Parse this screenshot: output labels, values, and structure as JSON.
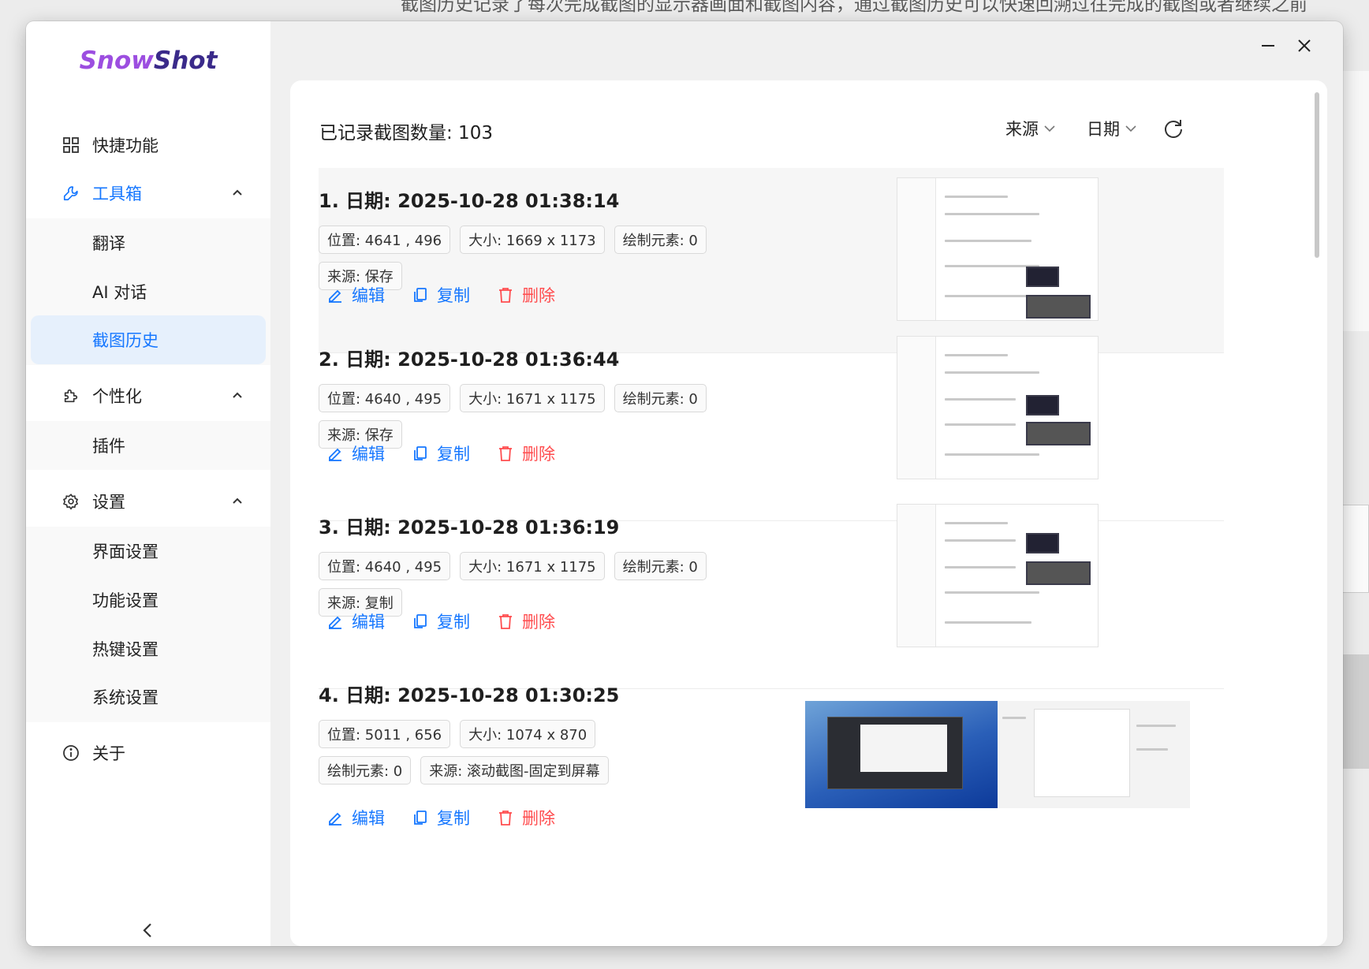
{
  "background": {
    "text": "截图历史记录了每次完成截图的显示器画面和截图内容，通过截图历史可以快速回溯过往完成的截图或者继续之前"
  },
  "app": {
    "logo_part1": "Snow",
    "logo_part2": "Shot"
  },
  "sidebar": {
    "quick": "快捷功能",
    "toolbox": "工具箱",
    "translate": "翻译",
    "ai_chat": "AI 对话",
    "history": "截图历史",
    "personalize": "个性化",
    "plugins": "插件",
    "settings": "设置",
    "ui_settings": "界面设置",
    "func_settings": "功能设置",
    "hotkey_settings": "热键设置",
    "system_settings": "系统设置",
    "about": "关于"
  },
  "content": {
    "count_label": "已记录截图数量: 103",
    "filter_source": "来源",
    "filter_date": "日期"
  },
  "actions": {
    "edit": "编辑",
    "copy": "复制",
    "delete": "删除"
  },
  "records": [
    {
      "title": "1. 日期: 2025-10-28 01:38:14",
      "position": "位置: 4641 , 496",
      "size": "大小: 1669 x 1173",
      "elements": "绘制元素: 0",
      "source": "来源: 保存"
    },
    {
      "title": "2. 日期: 2025-10-28 01:36:44",
      "position": "位置: 4640 , 495",
      "size": "大小: 1671 x 1175",
      "elements": "绘制元素: 0",
      "source": "来源: 保存"
    },
    {
      "title": "3. 日期: 2025-10-28 01:36:19",
      "position": "位置: 4640 , 495",
      "size": "大小: 1671 x 1175",
      "elements": "绘制元素: 0",
      "source": "来源: 复制"
    },
    {
      "title": "4. 日期: 2025-10-28 01:30:25",
      "position": "位置: 5011 , 656",
      "size": "大小: 1074 x 870",
      "elements": "绘制元素: 0",
      "source": "来源: 滚动截图-固定到屏幕"
    }
  ],
  "colors": {
    "accent": "#1677ff",
    "danger": "#ff4d4f",
    "logo_snow": "#9c4ee0",
    "logo_shot": "#3a2a8a"
  }
}
